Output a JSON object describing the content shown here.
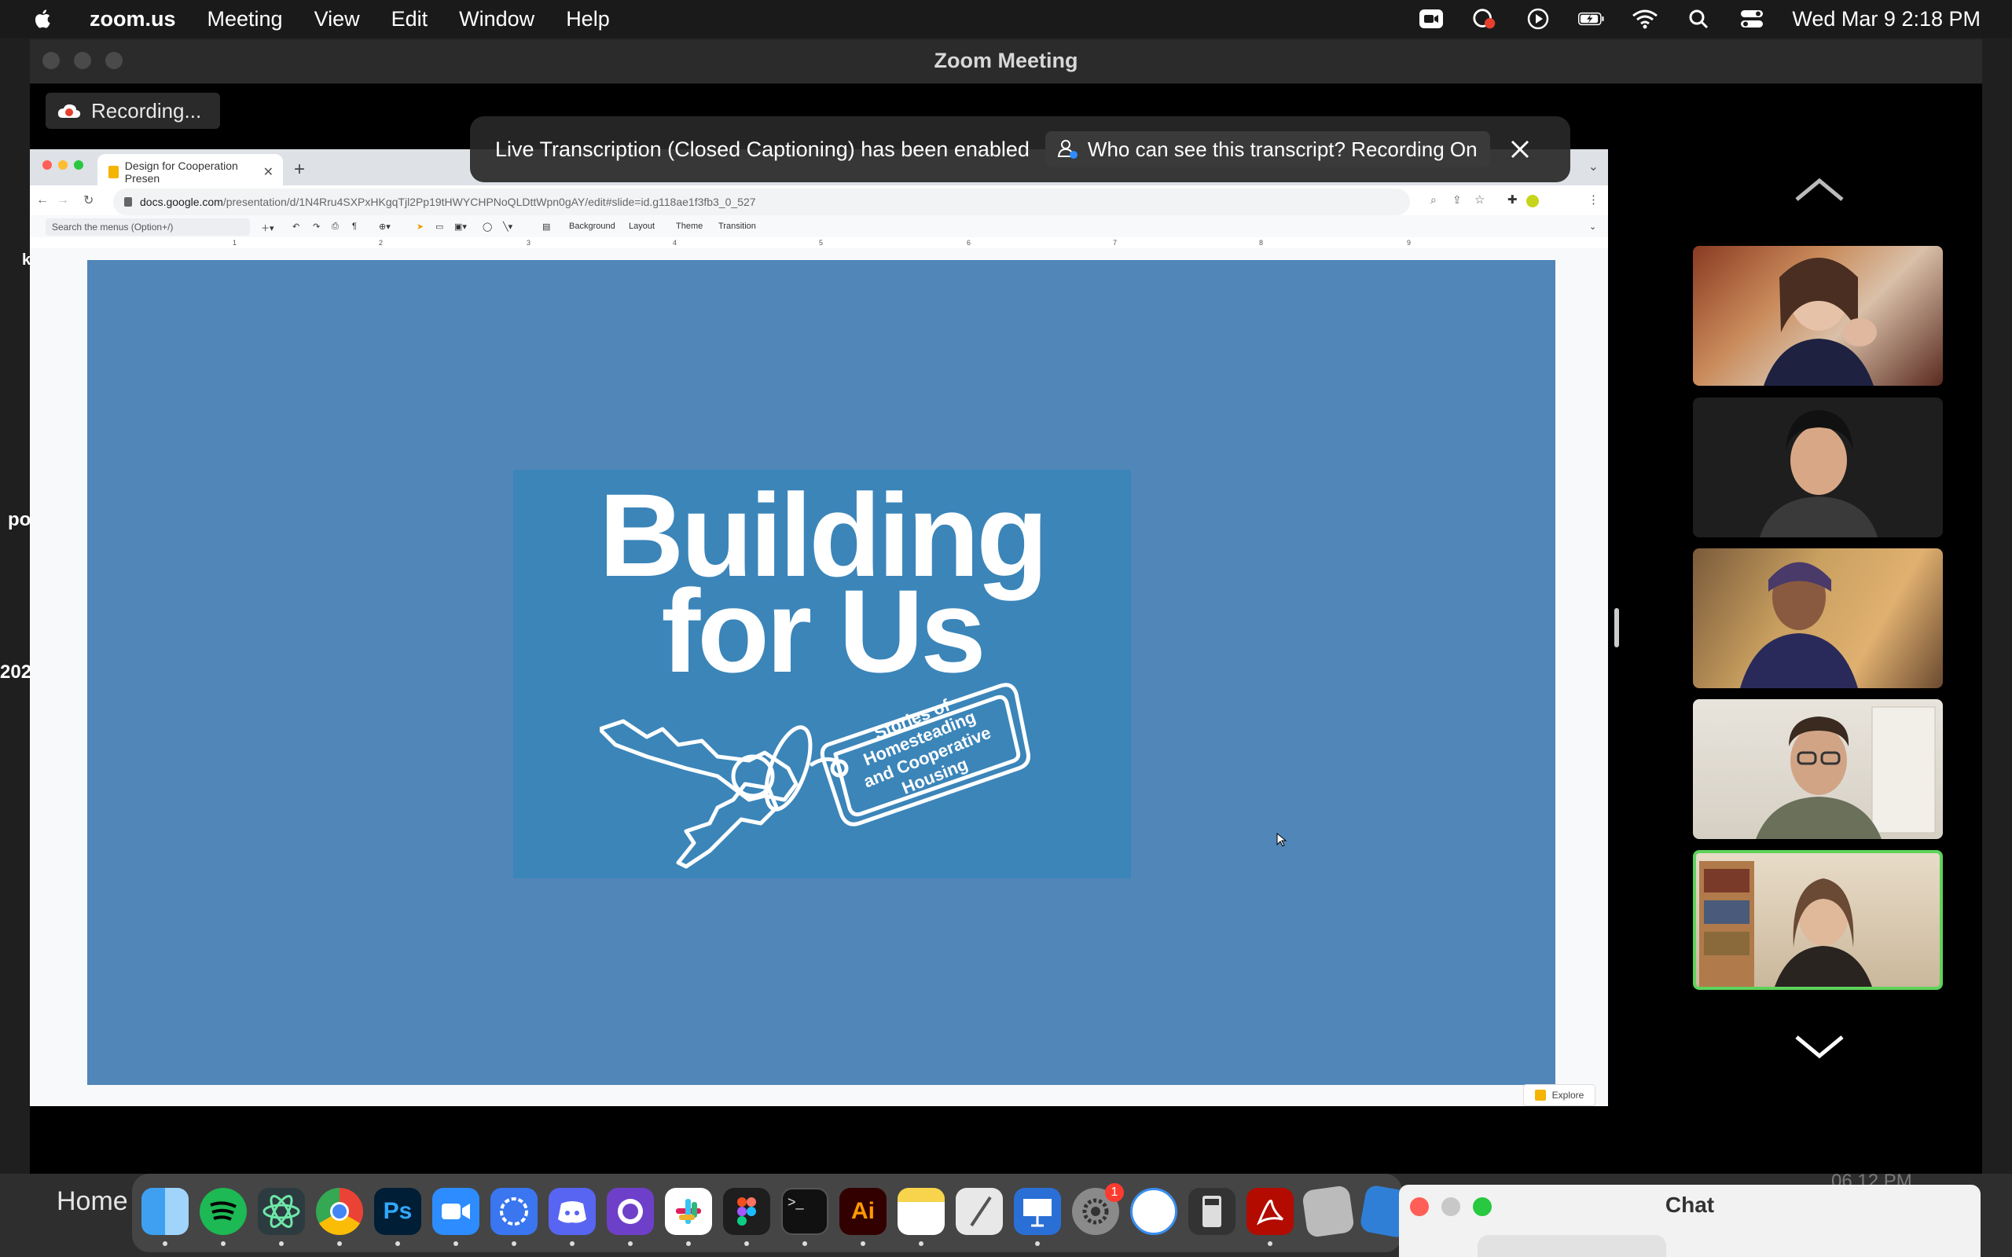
{
  "menubar": {
    "app_name": "zoom.us",
    "items": [
      "Meeting",
      "View",
      "Edit",
      "Window",
      "Help"
    ],
    "clock": "Wed Mar 9  2:18 PM"
  },
  "zoom": {
    "window_title": "Zoom Meeting",
    "recording_label": "Recording...",
    "banner": {
      "message": "Live Transcription (Closed Captioning) has been enabled",
      "button_label": "Who can see this transcript? Recording On"
    }
  },
  "browser": {
    "tab_title": "Design for Cooperation Presen",
    "url_host": "docs.google.com",
    "url_path": "/presentation/d/1N4Rru4SXPxHKgqTjl2Pp19tHWYCHPNoQLDttWpn0gAY/edit#slide=id.g118ae1f3fb3_0_527",
    "menu_search_placeholder": "Search the menus (Option+/)",
    "toolbar": {
      "background": "Background",
      "layout": "Layout",
      "theme": "Theme",
      "transition": "Transition"
    },
    "ruler_marks": [
      "1",
      "2",
      "3",
      "4",
      "5",
      "6",
      "7",
      "8",
      "9"
    ],
    "explore_label": "Explore"
  },
  "slide": {
    "title_line1": "Building",
    "title_line2": "for Us",
    "tag_text": "Stories of Homesteading and Cooperative Housing"
  },
  "participants": {
    "count": 5,
    "active_index": 4
  },
  "dock": {
    "home_label": "Home",
    "badge_count": "1"
  },
  "chat": {
    "title": "Chat"
  },
  "background": {
    "time_text": "06.12 PM"
  },
  "colors": {
    "slide_bg": "#5186b8",
    "logo_bg": "#3b85b9",
    "active_speaker": "#5ed35a"
  }
}
